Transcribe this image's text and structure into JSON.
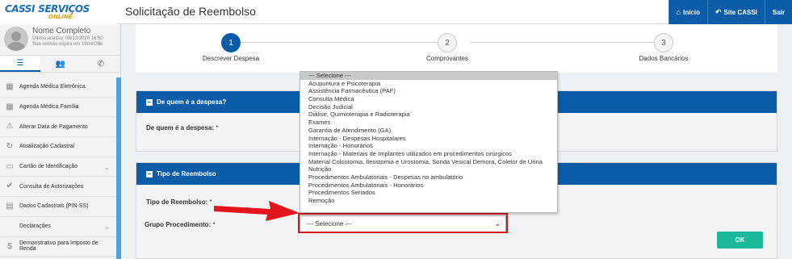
{
  "app": {
    "logo_main": "CASSI",
    "logo_sub_main": "SERVIÇOS",
    "logo_tagline": "ONLINE",
    "page_title": "Solicitação de Reembolso"
  },
  "topnav": {
    "items": [
      {
        "label": "Início",
        "icon": "home-icon"
      },
      {
        "label": "Site CASSI",
        "icon": "reply-icon"
      },
      {
        "label": "Sair",
        "icon": ""
      }
    ]
  },
  "user": {
    "name": "Nome Completo",
    "last_access": "Último acesso: 08/12/2020 16:50",
    "session": "Sua sessão expira em 19min35s"
  },
  "sidebar": {
    "tabs": [
      {
        "label": "☰",
        "icon": "menu-icon"
      },
      {
        "label": "👥",
        "icon": "users-icon"
      },
      {
        "label": "✆",
        "icon": "phone-icon"
      }
    ],
    "items": [
      {
        "label": "Agenda Médica Eletrônica",
        "icon": "calendar-icon",
        "chevron": false
      },
      {
        "label": "Agenda Médica Família",
        "icon": "calendar-icon",
        "chevron": false
      },
      {
        "label": "Alterar Data de Pagamento",
        "icon": "warning-icon",
        "chevron": false
      },
      {
        "label": "Atualização Cadastral",
        "icon": "refresh-icon",
        "chevron": false
      },
      {
        "label": "Cartão de Identificação",
        "icon": "card-icon",
        "chevron": true
      },
      {
        "label": "Consulta de Autorizações",
        "icon": "check-icon",
        "chevron": false
      },
      {
        "label": "Dados Cadastrais (PIN-SS)",
        "icon": "list-icon",
        "chevron": false
      },
      {
        "label": "Declarações",
        "icon": "",
        "chevron": true
      },
      {
        "label": "Demonstrativo para Imposto de Renda",
        "icon": "dollar-icon",
        "chevron": false
      }
    ]
  },
  "stepper": {
    "steps": [
      {
        "number": "1",
        "label": "Descrever Despesa",
        "active": true
      },
      {
        "number": "2",
        "label": "Comprovantes",
        "active": false
      },
      {
        "number": "3",
        "label": "Dados Bancários",
        "active": false
      }
    ]
  },
  "panel_despesa": {
    "title": "De quem é a despesa?",
    "field_label": "De quem é a despesa:",
    "required_mark": "*"
  },
  "panel_reembolso": {
    "title": "Tipo de Reembolso",
    "tipo_label": "Tipo de Reembolso:",
    "grupo_label": "Grupo Procedimento:",
    "required_mark": "*"
  },
  "grupo_select": {
    "value": "--- Selecione ---",
    "options": [
      "--- Selecione ---",
      "Acupuntura e Psicoterapia",
      "Assistência Farmacêutica (PAF)",
      "Consulta Médica",
      "Decisão Judicial",
      "Diálise, Quimioterapia e Radioterapia",
      "Exames",
      "Garantia de Atendimento (GA)",
      "Internação - Despesas Hospitalares",
      "Internação - Honorários",
      "Internação - Materiais de Implantes utilizados em procedimentos cirúrgicos",
      "Material Colostomia, Ileostomia e Urostomia, Sonda Vesical Demora, Coletor de Urina",
      "Nutrição",
      "Procedimentos Ambulatoriais - Despesas no ambulatório",
      "Procedimentos Ambulatoriais - Honorários",
      "Procedimentos Seriados",
      "Remoção"
    ]
  },
  "ok_button": {
    "label": "OK"
  },
  "colors": {
    "primary": "#0a5ca8",
    "ok": "#1bb99a",
    "highlight": "#d6141c",
    "sidebar_scroll": "#4aa3df"
  }
}
